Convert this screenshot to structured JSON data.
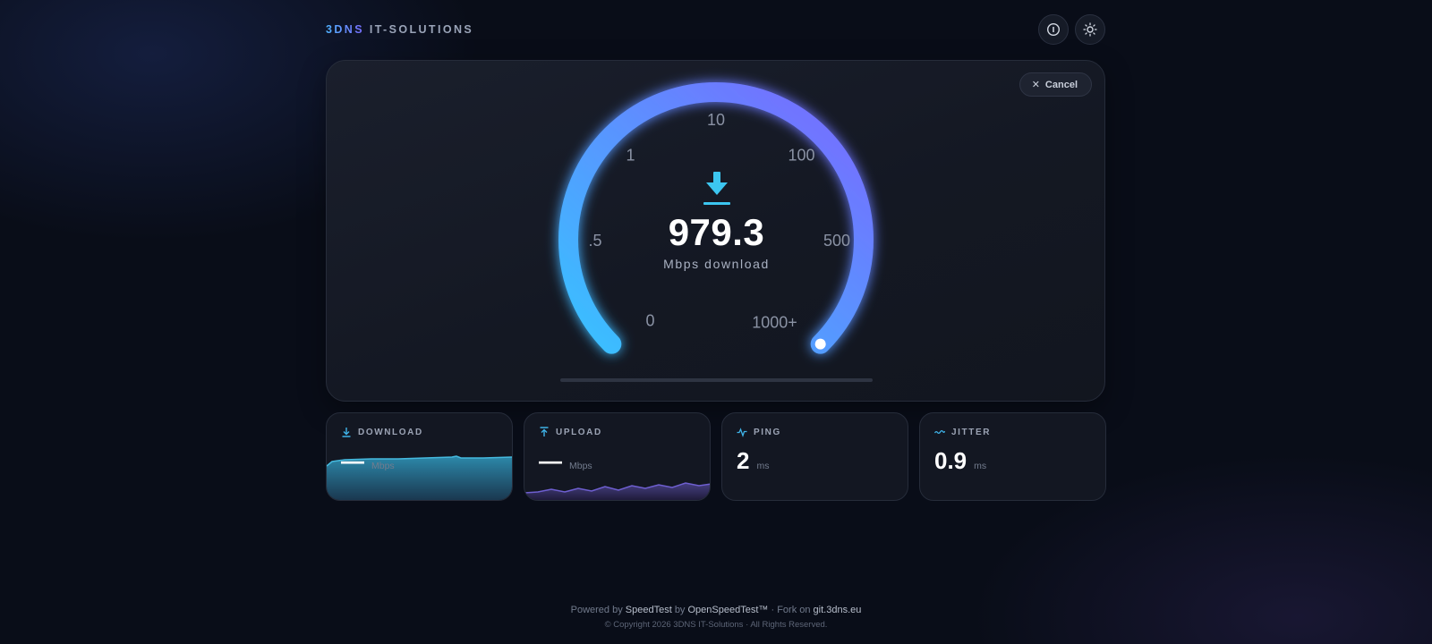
{
  "header": {
    "brand_part1": "3DNS",
    "brand_part2": "IT-SOLUTIONS",
    "info_icon": "info-icon",
    "theme_icon": "sun-icon"
  },
  "gauge": {
    "cancel_label": "Cancel",
    "scale_labels": [
      "0",
      ".5",
      "1",
      "10",
      "100",
      "500",
      "1000+"
    ],
    "value": "979.3",
    "unit_label": "Mbps download",
    "fill_fraction": 1.0,
    "colors": {
      "start": "#38c2ff",
      "end": "#7a67ff"
    }
  },
  "stats": {
    "download": {
      "label": "DOWNLOAD",
      "value": "—",
      "unit": "Mbps",
      "icon": "download-icon",
      "color": "#3fb3e8"
    },
    "upload": {
      "label": "UPLOAD",
      "value": "—",
      "unit": "Mbps",
      "icon": "upload-icon",
      "color": "#3fb3e8"
    },
    "ping": {
      "label": "PING",
      "value": "2",
      "unit": "ms",
      "icon": "pulse-icon",
      "color": "#3fb3e8"
    },
    "jitter": {
      "label": "JITTER",
      "value": "0.9",
      "unit": "ms",
      "icon": "wave-icon",
      "color": "#3fb3e8"
    }
  },
  "footer": {
    "powered_prefix": "Powered by",
    "speedtest": "SpeedTest",
    "by": "by",
    "openspeedtest": "OpenSpeedTest™",
    "sep": "·",
    "fork_prefix": "Fork on",
    "fork_link": "git.3dns.eu",
    "copyright": "© Copyright 2026 3DNS IT-Solutions · All Rights Reserved."
  }
}
